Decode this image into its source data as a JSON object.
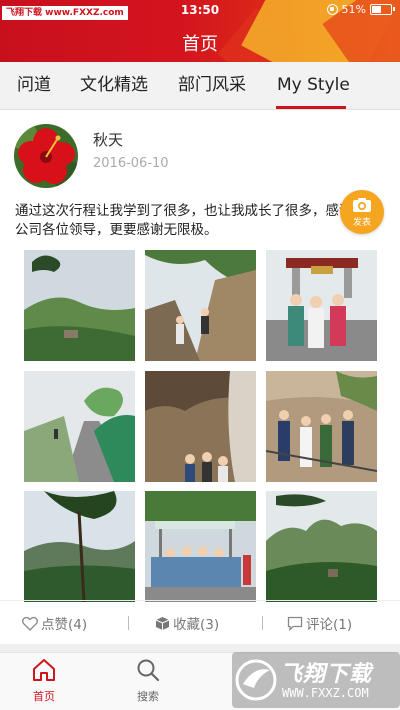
{
  "status_bar": {
    "watermark": "飞翔下载 www.FXXZ.com",
    "time": "13:50",
    "battery": "51%",
    "battery_level": 0.51
  },
  "header": {
    "title": "首页"
  },
  "tabs": [
    {
      "label": "问道",
      "active": false
    },
    {
      "label": "文化精选",
      "active": false
    },
    {
      "label": "部门风采",
      "active": false
    },
    {
      "label": "My Style",
      "active": true
    }
  ],
  "post": {
    "author": "秋天",
    "date": "2016-06-10",
    "text": "通过这次行程让我学到了很多，也让我成长了很多，感谢公司各位领导，更要感谢无限极。",
    "photos": [
      "mountain-pines-photo",
      "rock-climbers-photo",
      "temple-gate-group-photo",
      "road-trees-photo",
      "cave-group-photo",
      "trail-group-photo",
      "pine-valley-photo",
      "sightseeing-cart-photo",
      "mountain-peaks-photo"
    ]
  },
  "fab": {
    "label": "发表",
    "icon": "camera-icon"
  },
  "actions": {
    "like": "点赞(4)",
    "collect": "收藏(3)",
    "comment": "评论(1)"
  },
  "bottom_nav": [
    {
      "label": "首页",
      "icon": "home-icon",
      "active": true
    },
    {
      "label": "搜索",
      "icon": "search-icon",
      "active": false
    }
  ],
  "watermark_bottom": {
    "brand": "飞翔下载",
    "url": "WWW.FXXZ.COM"
  },
  "colors": {
    "accent": "#d0141d",
    "fab": "#f5a51f",
    "header_gradient_end": "#f08a1a"
  }
}
